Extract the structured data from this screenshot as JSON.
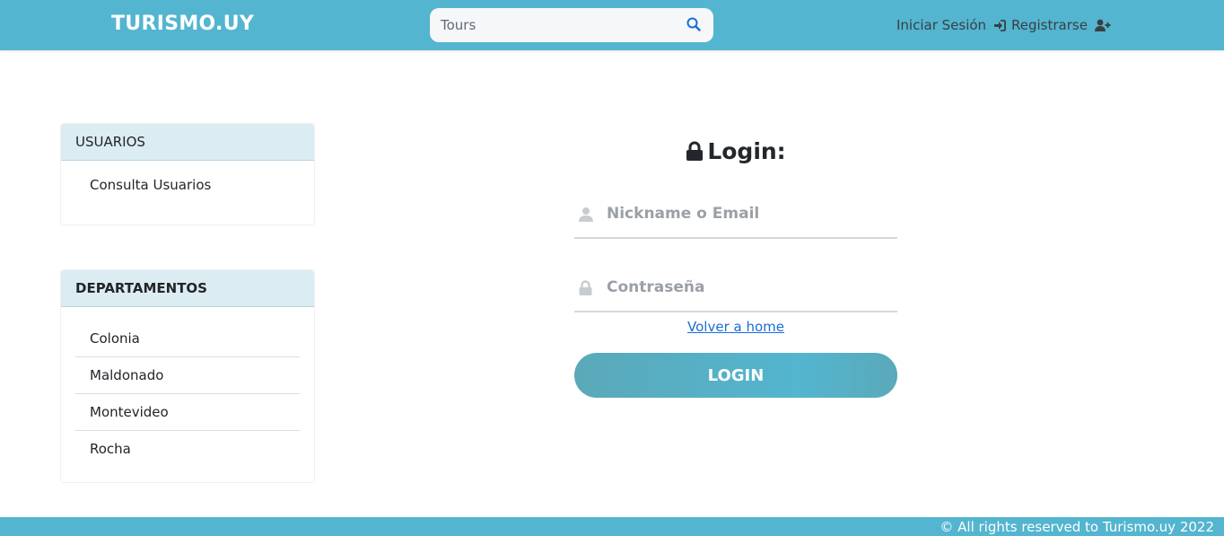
{
  "header": {
    "brand": "TURISMO.UY",
    "search": {
      "placeholder": "Tours",
      "icon": "search-icon"
    },
    "login_link": "Iniciar Sesión",
    "register_link": "Registrarse"
  },
  "sidebar": {
    "users_card": {
      "title": "USUARIOS",
      "items": [
        {
          "label": "Consulta Usuarios"
        }
      ]
    },
    "departments_card": {
      "title": "DEPARTAMENTOS",
      "items": [
        {
          "label": "Colonia"
        },
        {
          "label": "Maldonado"
        },
        {
          "label": "Montevideo"
        },
        {
          "label": "Rocha"
        }
      ]
    }
  },
  "login_form": {
    "title": "Login:",
    "nickname_placeholder": "Nickname o Email",
    "password_placeholder": "Contraseña",
    "home_link": "Volver a home",
    "submit_label": "LOGIN"
  },
  "footer": {
    "text": "© All rights reserved to Turismo.uy 2022"
  },
  "colors": {
    "primary": "#53b5cf",
    "card_header": "#dcecf3",
    "link": "#1a6dd6"
  }
}
